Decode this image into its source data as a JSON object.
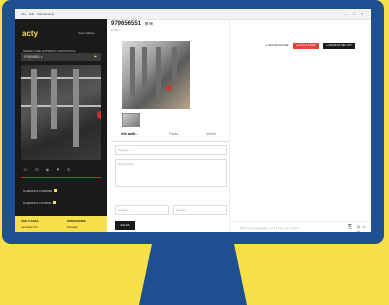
{
  "app": {
    "menu": [
      "File",
      "Edit",
      "Window",
      "Help"
    ],
    "window_controls": [
      "–",
      "□",
      "×"
    ]
  },
  "sidebar": {
    "logo": "acty",
    "header_right": "Testo Milano",
    "subtitle": "GREEN ONE EXPRESS ASSISTANCE",
    "search_value": "979656551 ▾",
    "icons": "☏ ✉ ◉ ⚑ ⚙",
    "status_items": [
      {
        "label": "CLIENTE IN ORDINE",
        "color": "#f7e04a"
      },
      {
        "label": "CLIENTE IN CORSO",
        "color": "#f7e04a"
      }
    ],
    "footer": {
      "left_title": "CHE CASSA",
      "left_sub": "Lavorato 5.0",
      "right_title": "OPERATORE",
      "right_sub": "Perugia"
    }
  },
  "panel": {
    "title": "979656551",
    "title_icons": "☰ ✉",
    "subtitle": "● Attivo",
    "tabs": [
      "Info addit...",
      "Pianta",
      "Attività"
    ],
    "active_tab": 0,
    "fields": {
      "subject_placeholder": "Oggetto",
      "description_placeholder": "Descrizione",
      "small_left_placeholder": "Reparto",
      "small_right_placeholder": "Durata"
    },
    "save_label": "SALVA"
  },
  "actions": {
    "btn1": "● SEGNALAZIONE",
    "btn2": "● INVIA A STAFF",
    "btn3": "● ARCHIVIA NEL CPT"
  },
  "chat": {
    "placeholder": "Scrivi un messaggio o usa il form per inviare...",
    "icons": "☺ ⌂ ◎"
  },
  "colors": {
    "background": "#f7e04a",
    "monitor": "#1d4f91",
    "accent": "#f7e04a",
    "red": "#e0443a"
  }
}
